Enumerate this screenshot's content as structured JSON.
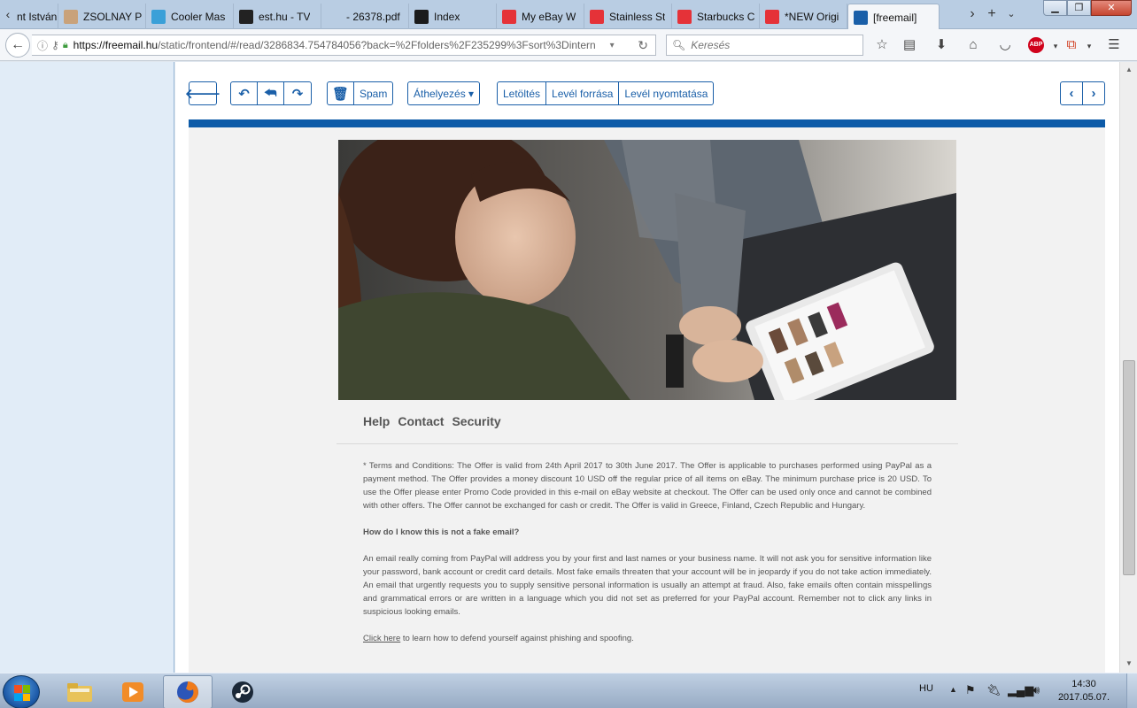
{
  "browser": {
    "tabs": [
      {
        "label": "nt István",
        "icon": "none-icon",
        "color": "#b9cde3"
      },
      {
        "label": "ZSOLNAY P",
        "icon": "zsolnay-icon",
        "color": "#c9a27a"
      },
      {
        "label": "Cooler Mas",
        "icon": "cooler-icon",
        "color": "#3aa0d8"
      },
      {
        "label": "est.hu - TV",
        "icon": "esthu-icon",
        "color": "#222222"
      },
      {
        "label": "- 26378.pdf",
        "icon": "pdf-icon",
        "color": "#b9cde3"
      },
      {
        "label": "Index",
        "icon": "index-icon",
        "color": "#1b1b1b"
      },
      {
        "label": "My eBay W",
        "icon": "ebay-icon",
        "color": "#e53238"
      },
      {
        "label": "Stainless St",
        "icon": "ebay-icon",
        "color": "#e53238"
      },
      {
        "label": "Starbucks C",
        "icon": "ebay-icon",
        "color": "#e53238"
      },
      {
        "label": "*NEW Origi",
        "icon": "ebay-icon",
        "color": "#e53238"
      },
      {
        "label": "[freemail]",
        "icon": "freemail-icon",
        "color": "#1a5fa8",
        "active": true
      }
    ],
    "url_host": "https://freemail.hu",
    "url_path": "/static/frontend/#/read/3286834.754784056?back=%2Ffolders%2F235299%3Fsort%3Dintern",
    "search_placeholder": "Keresés",
    "abp_label": "ABP"
  },
  "mail_toolbar": {
    "spam_label": "Spam",
    "move_label": "Áthelyezés ▾",
    "download_label": "Letöltés",
    "source_label": "Levél forrása",
    "print_label": "Levél nyomtatása"
  },
  "email": {
    "footer_links": [
      "Help",
      "Contact",
      "Security"
    ],
    "terms": "* Terms and Conditions: The Offer is valid from 24th April 2017 to 30th June 2017. The Offer is applicable to purchases performed using PayPal as a payment method. The Offer provides a money discount 10 USD off the regular price of all items on eBay. The minimum purchase price is 20 USD. To use the Offer please enter Promo Code provided in this e-mail on eBay website at checkout. The Offer can be used only once and cannot be combined with other offers. The Offer cannot be exchanged for cash or credit. The Offer is valid in Greece, Finland, Czech Republic and Hungary.",
    "fake_heading": "How do I know this is not a fake email?",
    "fake_body": "An email really coming from PayPal will address you by your first and last names or your business name. It will not ask you for sensitive information like your password, bank account or credit card details. Most fake emails threaten that your account will be in jeopardy if you do not take action immediately. An email that urgently requests you to supply sensitive personal information is usually an attempt at fraud. Also, fake emails often contain misspellings and grammatical errors or are written in a language which you did not set as preferred for your PayPal account. Remember not to click any links in suspicious looking emails.",
    "click_here": "Click here",
    "click_here_rest": " to learn how to defend yourself against phishing and spoofing."
  },
  "taskbar": {
    "lang": "HU",
    "time": "14:30",
    "date": "2017.05.07."
  },
  "colors": {
    "accent": "#1a5fa8",
    "rule": "#0d5ba8"
  }
}
